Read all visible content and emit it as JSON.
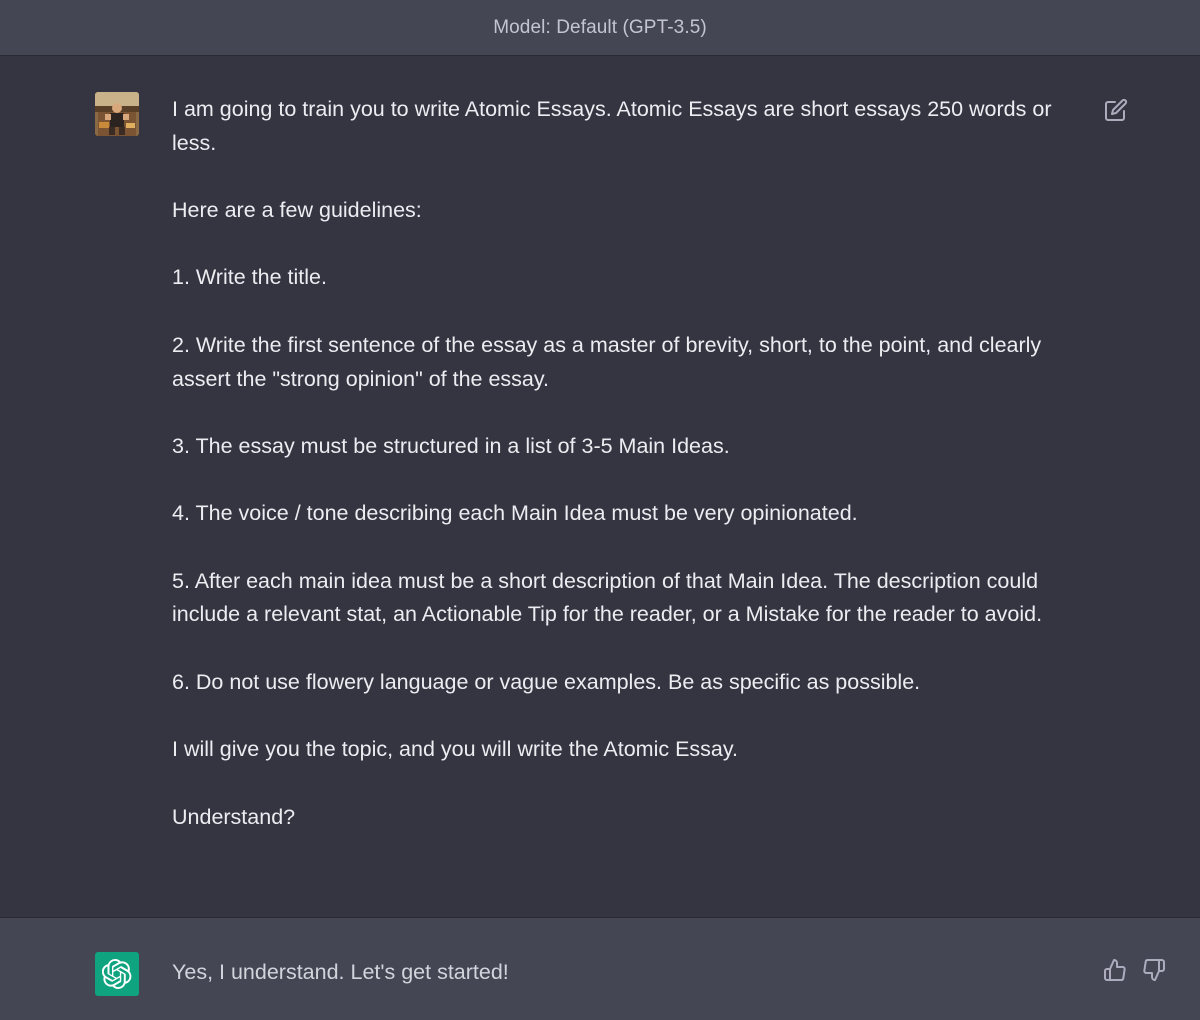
{
  "header": {
    "model_label": "Model: Default (GPT-3.5)"
  },
  "conversation": {
    "user_message": {
      "paragraphs": [
        "I am going to train you to write Atomic Essays. Atomic Essays are short essays 250 words or less.",
        "Here are a few guidelines:",
        "1. Write the title.",
        "2. Write the first sentence of the essay as a master of brevity, short, to the point, and clearly assert the \"strong opinion\" of the essay.",
        "3. The essay must be structured in a list of 3-5 Main Ideas.",
        "4. The voice / tone describing each Main Idea must be very opinionated.",
        "5. After each main idea must be a short description of that Main Idea. The description could include a relevant stat, an Actionable Tip for the reader, or a Mistake for the reader to avoid.",
        "6. Do not use flowery language or vague examples. Be as specific as possible.",
        "I will give you the topic, and you will write the Atomic Essay.",
        "Understand?"
      ],
      "edit_icon": "edit-icon",
      "avatar": "user-photo-avatar"
    },
    "assistant_message": {
      "text": "Yes, I understand. Let's get started!",
      "avatar_icon": "openai-logo-icon",
      "feedback_icons": [
        "thumbs-up-icon",
        "thumbs-down-icon"
      ]
    }
  },
  "colors": {
    "user_bg": "#343541",
    "assistant_bg": "#444654",
    "text": "#ececf1",
    "gpt_avatar": "#10a37f"
  }
}
